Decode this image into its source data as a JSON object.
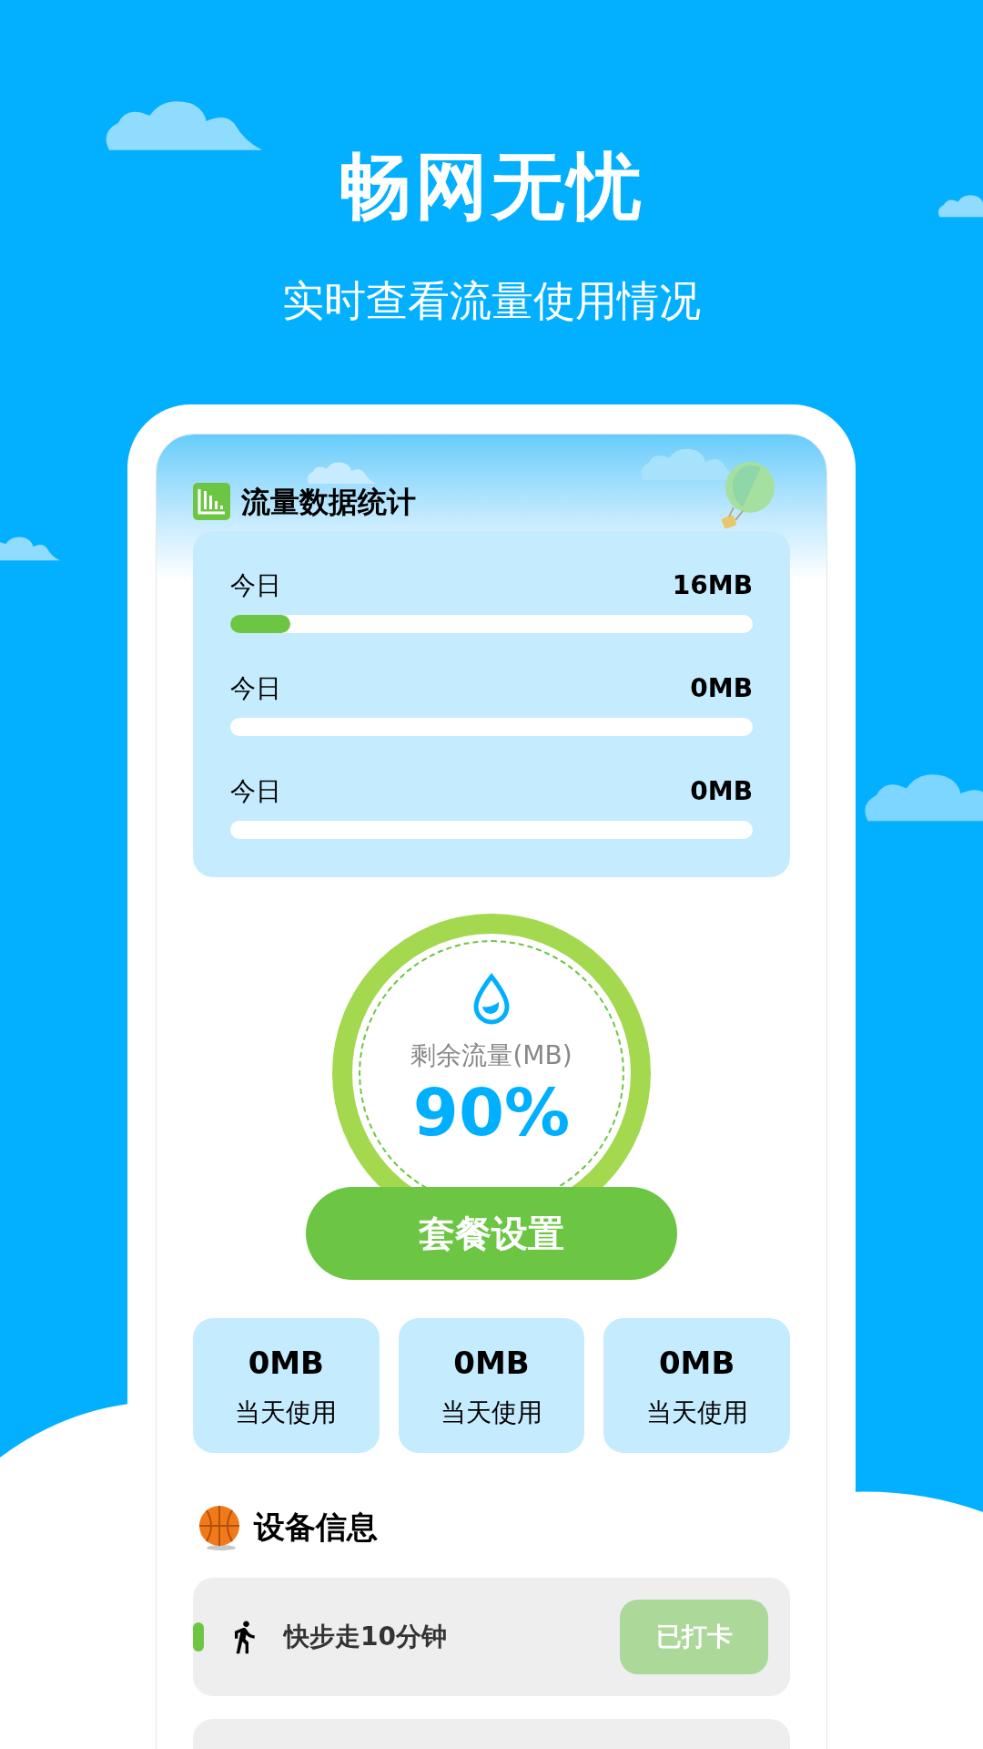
{
  "headline": "畅网无忧",
  "subheadline": "实时查看流量使用情况",
  "stats_panel": {
    "title": "流量数据统计",
    "rows": [
      {
        "label": "今日",
        "value": "16MB",
        "level": 0.115
      },
      {
        "label": "今日",
        "value": "0MB"
      },
      {
        "label": "今日",
        "value": "0MB"
      }
    ]
  },
  "remaining": {
    "label": "剩余流量(MB)",
    "percent": "90%"
  },
  "plan_button": "套餐设置",
  "usage_cards": [
    {
      "value": "0MB",
      "label": "当天使用"
    },
    {
      "value": "0MB",
      "label": "当天使用"
    },
    {
      "value": "0MB",
      "label": "当天使用"
    }
  ],
  "device_section": {
    "title": "设备信息",
    "tasks": [
      {
        "title": "快步走10分钟",
        "action": "已打卡",
        "done": true
      }
    ]
  }
}
